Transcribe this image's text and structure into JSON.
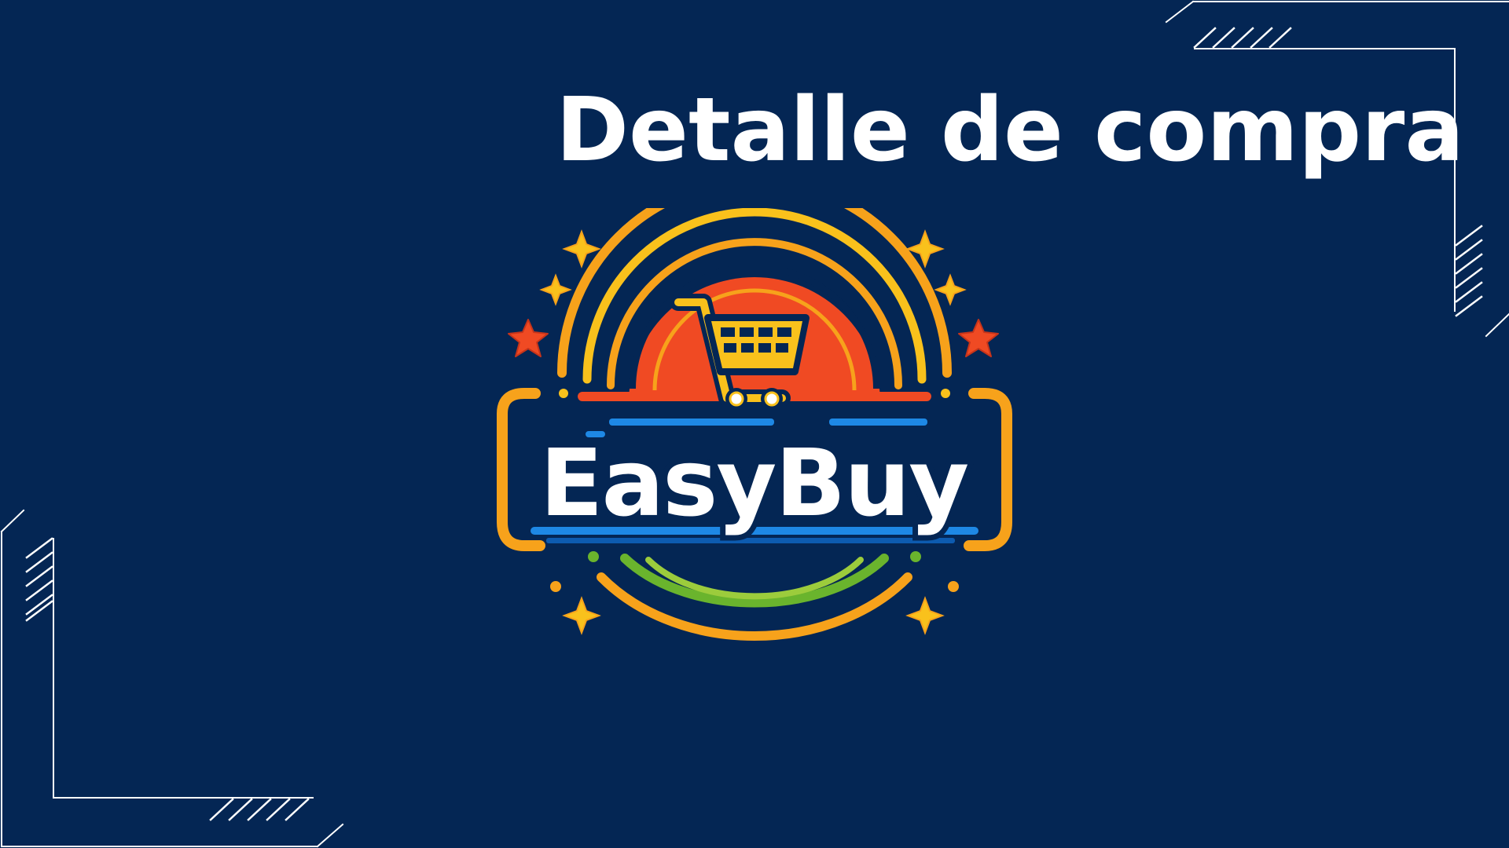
{
  "slide": {
    "title": "Detalle de compra",
    "background_color": "#042654"
  },
  "logo": {
    "wordmark": "EasyBuy",
    "icon": "shopping-cart-icon",
    "colors": {
      "orange": "#f7a21b",
      "red": "#f04a23",
      "yellow": "#f9c11c",
      "blue": "#1e88e5",
      "green": "#6ab42d",
      "white": "#ffffff",
      "navy": "#042654"
    }
  },
  "decorations": {
    "frame_color": "#ffffff"
  }
}
